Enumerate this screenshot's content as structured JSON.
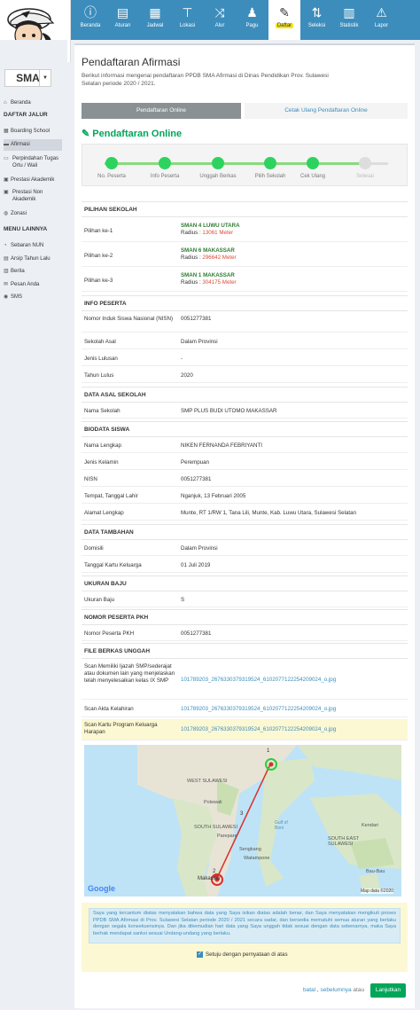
{
  "nav": [
    {
      "label": "Beranda",
      "icon": "info-icon"
    },
    {
      "label": "Aturan",
      "icon": "book-icon"
    },
    {
      "label": "Jadwal",
      "icon": "calendar-check-icon"
    },
    {
      "label": "Lokasi",
      "icon": "signpost-icon"
    },
    {
      "label": "Alur",
      "icon": "shuffle-icon"
    },
    {
      "label": "Pagu",
      "icon": "users-icon"
    },
    {
      "label": "Daftar",
      "icon": "pencil-icon"
    },
    {
      "label": "Seleksi",
      "icon": "sort-numeric-icon"
    },
    {
      "label": "Statistik",
      "icon": "bar-chart-icon"
    },
    {
      "label": "Lapor",
      "icon": "alert-icon"
    }
  ],
  "sidebar": {
    "level": "SMA",
    "daftar_jalur": "DAFTAR JALUR",
    "menu_lainnya": "MENU LAINNYA",
    "home": "Beranda",
    "jalur": [
      "Boarding School",
      "Afirmasi",
      "Perpindahan Tugas Ortu / Wali",
      "Prestasi Akademik",
      "Prestasi Non Akademik",
      "Zonasi"
    ],
    "lain": [
      "Sebaran NUN",
      "Arsip Tahun Lalu",
      "Berita",
      "Pesan Anda",
      "SMS"
    ]
  },
  "page": {
    "title": "Pendaftaran Afirmasi",
    "desc": "Berikut informasi mengenai pendaftaran PPDB SMA Afirmasi di Dinas Pendidikan Prov. Sulawesi Selatan periode 2020 / 2021.",
    "tab_online": "Pendaftaran Online",
    "tab_cetak": "Cetak Ulang Pendaftaran Online",
    "heading": "Pendaftaran Online",
    "steps": [
      "No. Peserta",
      "Info Peserta",
      "Unggah Berkas",
      "Pilih Sekolah",
      "Cek Ulang",
      "Selesai"
    ]
  },
  "pilihan": {
    "section": "PILIHAN SEKOLAH",
    "items": [
      {
        "label": "Pilihan ke-1",
        "school": "SMAN 4 LUWU UTARA",
        "radius_label": "Radius : ",
        "radius": "13061 Meter"
      },
      {
        "label": "Pilihan ke-2",
        "school": "SMAN 6 MAKASSAR",
        "radius_label": "Radius : ",
        "radius": "296642 Meter"
      },
      {
        "label": "Pilihan ke-3",
        "school": "SMAN 1 MAKASSAR",
        "radius_label": "Radius : ",
        "radius": "304175 Meter"
      }
    ]
  },
  "info_peserta": {
    "section": "INFO PESERTA",
    "rows": [
      {
        "k": "Nomor Induk Siswa Nasional (NISN)",
        "v": "0051277381"
      },
      {
        "k": "Sekolah Asal",
        "v": "Dalam Provinsi"
      },
      {
        "k": "Jenis Lulusan",
        "v": "-"
      },
      {
        "k": "Tahun Lulus",
        "v": "2020"
      }
    ]
  },
  "asal_sekolah": {
    "section": "DATA ASAL SEKOLAH",
    "k": "Nama Sekolah",
    "v": "SMP PLUS BUDI UTOMO MAKASSAR"
  },
  "biodata": {
    "section": "BIODATA SISWA",
    "rows": [
      {
        "k": "Nama Lengkap",
        "v": "NIKEN FERNANDA FEBRIYANTI"
      },
      {
        "k": "Jenis Kelamin",
        "v": "Perempuan"
      },
      {
        "k": "NISN",
        "v": "0051277381"
      },
      {
        "k": "Tempat, Tanggal Lahir",
        "v": "Nganjuk, 13 Februari 2005"
      },
      {
        "k": "Alamat Lengkap",
        "v": "Munte, RT 1/RW 1, Tana Lili, Munte, Kab. Luwu Utara, Sulawesi Selatan"
      }
    ]
  },
  "tambahan": {
    "section": "DATA TAMBAHAN",
    "rows": [
      {
        "k": "Domisili",
        "v": "Dalam Provinsi"
      },
      {
        "k": "Tanggal Kartu Keluarga",
        "v": "01 Juli 2019"
      }
    ]
  },
  "baju": {
    "section": "UKURAN BAJU",
    "k": "Ukuran Baju",
    "v": "S"
  },
  "pkh": {
    "section": "NOMOR PESERTA PKH",
    "k": "Nomor Peserta PKH",
    "v": "0051277381"
  },
  "berkas": {
    "section": "FILE BERKAS UNGGAH",
    "rows": [
      {
        "k": "Scan Memiliki Ijazah SMP/sederajat atau dokumen lain yang menjelaskan telah menyelesaikan kelas IX SMP",
        "v": "101789203_2676330379319524_6102077122254209024_o.jpg"
      },
      {
        "k": "Scan Akta Kelahiran",
        "v": "101789203_2676330379319524_6102077122254209024_o.jpg"
      },
      {
        "k": "Scan Kartu Program Keluarga Harapan",
        "v": "101789203_2676330379319524_6102077122254209024_o.jpg"
      }
    ]
  },
  "map": {
    "labels": [
      "WEST SULAWESI",
      "Polewali",
      "Parepare",
      "SOUTH SULAWESI",
      "Sengkang",
      "Watampone",
      "Makassar",
      "SOUTH EAST SULAWESI",
      "Gulf of Boni",
      "Kendari",
      "Bau-Bau"
    ],
    "marker_top": "1",
    "marker_mid": "3",
    "marker_bottom": "2",
    "google": "Google",
    "attribution": "Map data ©2020"
  },
  "agreement": {
    "text": "Saya yang tercantum diatas menyatakan bahwa data yang Saya isikan diatas adalah benar, dan Saya menyatakan mengikuti proses PPDB SMA Afirmasi di Prov. Sulawesi Selatan periode 2020 / 2021 secara sadar, dan bersedia mematuhi semua aturan yang berlaku dengan segala konsekuensinya. Dan jika dikemudian hari data yang Saya unggah tidak sesuai dengan data sebenarnya, maka Saya berhak mendapat sanksi sesuai Undang-undang yang berlaku.",
    "check": "Setuju dengan pernyataan di atas"
  },
  "footer": {
    "batal": "batal",
    "sebelumnya": "sebelumnya",
    "atau": "atau",
    "lanjutkan": "Lanjutkan"
  },
  "colors": {
    "brand": "#3c8dbc",
    "success": "#00a65a",
    "danger": "#dd4b39",
    "warn_bg": "#fcf8d3"
  }
}
